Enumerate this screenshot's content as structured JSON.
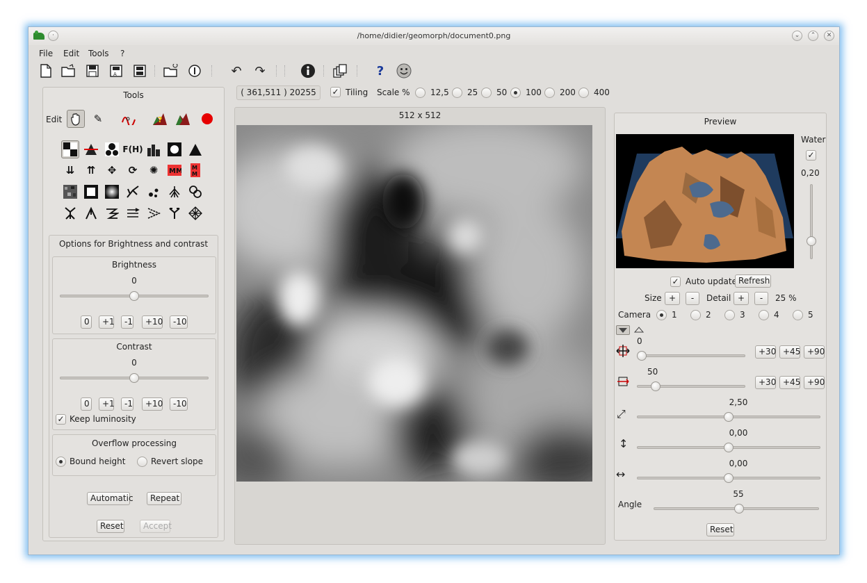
{
  "window": {
    "title": "/home/didier/geomorph/document0.png"
  },
  "menu": [
    "File",
    "Edit",
    "Tools",
    "?"
  ],
  "toolbar_icons": [
    "new-file-icon",
    "open-file-icon",
    "save-icon",
    "save-as-icon",
    "save-all-icon",
    "open-recent-icon",
    "close-icon",
    "undo-icon",
    "redo-icon",
    "info-icon",
    "windows-icon",
    "help-icon",
    "smiley-icon"
  ],
  "status": {
    "coords": "( 361,511 ) 20255",
    "tiling_label": "Tiling",
    "tiling_checked": true,
    "scale_label": "Scale %",
    "scale_options": [
      "12,5",
      "25",
      "50",
      "100",
      "200",
      "400"
    ],
    "scale_selected": "100"
  },
  "tools": {
    "title": "Tools",
    "edit_label": "Edit",
    "edit_icons": [
      "hand-icon",
      "pencil-icon",
      "spline-icon",
      "terrain-question-icon",
      "terrain-icon",
      "record-icon"
    ],
    "grid_icons": [
      [
        "brightness-contrast-icon",
        "threshold-icon",
        "fill-icon",
        "fh-label",
        "city-icon",
        "lightbulb-icon",
        "mountain-icon"
      ],
      [
        "merge-down-icon",
        "merge-up-icon",
        "move-icon",
        "rotate-icon",
        "sparkle-icon",
        "mirror-horizontal-icon",
        "mirror-vertical-icon"
      ],
      [
        "noise-icon",
        "frame-icon",
        "gradient-icon",
        "crack-icon",
        "drops-icon",
        "erosion-icon",
        "worm-icon"
      ],
      [
        "branches-icon",
        "river-icon",
        "stairs-icon",
        "waves-icon",
        "scatter-icon",
        "fork-icon",
        "mesh-icon"
      ]
    ],
    "fh_text": "F(H)"
  },
  "options": {
    "title": "Options for Brightness and contrast",
    "brightness": {
      "title": "Brightness",
      "value": "0",
      "level": 0.5,
      "buttons": [
        "0",
        "+1",
        "-1",
        "+10",
        "-10"
      ]
    },
    "contrast": {
      "title": "Contrast",
      "value": "0",
      "level": 0.5,
      "buttons": [
        "0",
        "+1",
        "-1",
        "+10",
        "-10"
      ]
    },
    "keep_luminosity": "Keep luminosity",
    "keep_luminosity_checked": true,
    "overflow": {
      "title": "Overflow processing",
      "bound_height": "Bound height",
      "revert_slope": "Revert slope",
      "selected": "Bound height"
    },
    "automatic": "Automatic",
    "repeat": "Repeat",
    "reset": "Reset",
    "accept": "Accept"
  },
  "canvas": {
    "title": "512 x 512"
  },
  "preview": {
    "title": "Preview",
    "water_label": "Water",
    "water_checked": true,
    "water_value": "0,20",
    "water_level": 0.2,
    "auto_update": "Auto update",
    "auto_update_checked": true,
    "refresh": "Refresh",
    "size_label": "Size",
    "plus": "+",
    "minus": "-",
    "detail_label": "Detail",
    "detail_value": "25 %",
    "camera_label": "Camera",
    "cameras": [
      "1",
      "2",
      "3",
      "4",
      "5"
    ],
    "camera_selected": "1",
    "rot1": {
      "value": "0",
      "level": 0.0
    },
    "rot2": {
      "value": "50",
      "level": 0.14
    },
    "angle_buttons": [
      "+30",
      "+45",
      "+90"
    ],
    "zoom": {
      "value": "2,50",
      "level": 0.5
    },
    "vertical": {
      "value": "0,00",
      "level": 0.5
    },
    "horizontal": {
      "value": "0,00",
      "level": 0.5
    },
    "angle": {
      "label": "Angle",
      "value": "55",
      "level": 0.52
    },
    "reset": "Reset",
    "colors": {
      "terrain": "#c98a55",
      "water": "#2e4a6b",
      "background": "#000000"
    }
  }
}
